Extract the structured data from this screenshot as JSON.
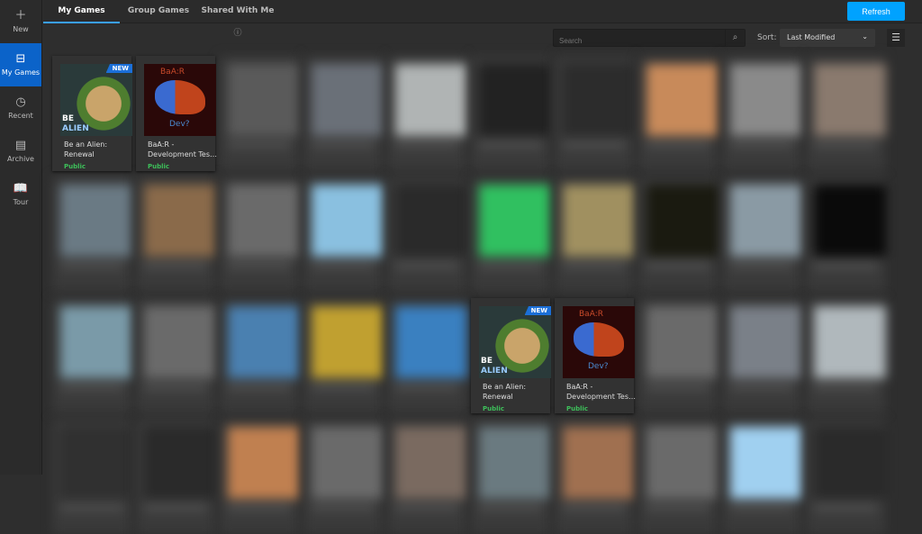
{
  "sidebar": {
    "items": [
      {
        "label": "New",
        "icon": "plus-icon"
      },
      {
        "label": "My Games",
        "icon": "briefcase-icon",
        "active": true
      },
      {
        "label": "Recent",
        "icon": "clock-icon"
      },
      {
        "label": "Archive",
        "icon": "archive-icon"
      },
      {
        "label": "Tour",
        "icon": "book-icon"
      }
    ]
  },
  "tabs": [
    {
      "label": "My Games"
    },
    {
      "label": "Group Games"
    },
    {
      "label": "Shared With Me"
    }
  ],
  "toolbar": {
    "refresh": "Refresh",
    "search_placeholder": "Search",
    "sort_label": "Sort:",
    "sort_value": "Last Modified"
  },
  "games": [
    {
      "name": "Be an Alien: Renewal",
      "status": "Public",
      "badge": "NEW",
      "thumb_text1": "BE",
      "thumb_text2": "ALIEN"
    },
    {
      "name": "BaA:R - Development Tes…",
      "status": "Public",
      "thumb_text1": "BaA:R",
      "thumb_text2": "Dev?"
    }
  ],
  "blurred_colors": [
    [
      "",
      "",
      "#5a5a5a",
      "#6a7078",
      "#b0b4b4",
      "#222222",
      "#2c2c2c",
      "#c88a5a",
      "#8a8a8a",
      "#8a7a6e"
    ],
    [
      "#6a7a84",
      "#8a6a4a",
      "#6a6a6a",
      "#8ac0e0",
      "#2a2a2a",
      "#30c060",
      "#a09060",
      "#1a1a10",
      "#8a9aa4",
      "#0a0a0a"
    ],
    [
      "#7a9aa8",
      "#6a6a6a",
      "#4a80b0",
      "#c0a030",
      "#3a80c0",
      "",
      "",
      "#6a6a6a",
      "#7a8088",
      "#b0b8bc"
    ],
    [
      "#303030",
      "#2a2a2a",
      "#c08050",
      "#6a6a6a",
      "#7a6a60",
      "#6a7a80",
      "#a07050",
      "#6a6a6a",
      "#a0d0f0",
      "#2a2a2a"
    ]
  ]
}
